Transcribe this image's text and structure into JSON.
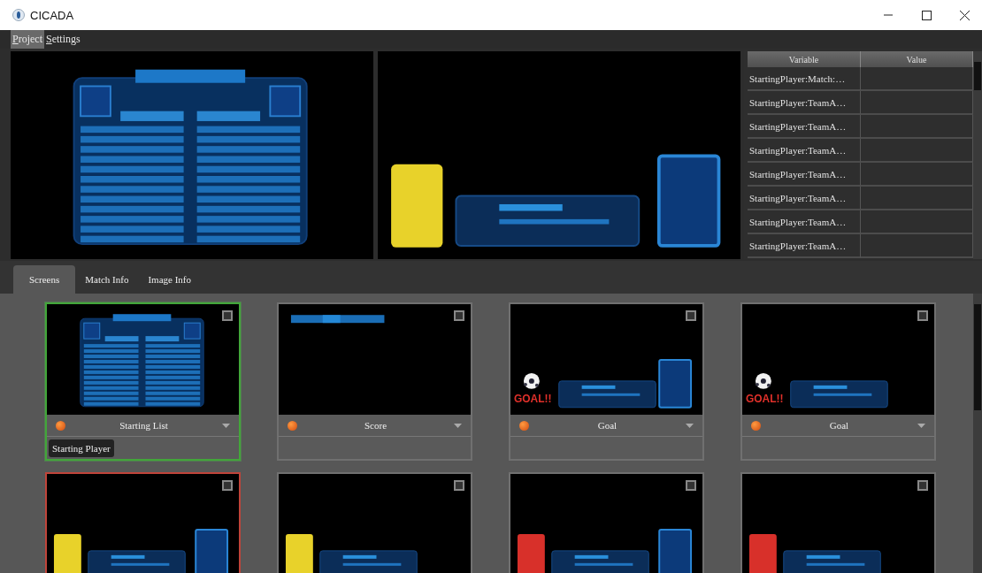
{
  "window": {
    "title": "CICADA"
  },
  "menu": [
    {
      "label": "Project",
      "selected": true
    },
    {
      "label": "Settings",
      "selected": false
    }
  ],
  "previews": [
    {
      "kind": "list"
    },
    {
      "kind": "card",
      "color": "#e8d22a",
      "side_box": true
    }
  ],
  "variables": {
    "columns": [
      "Variable",
      "Value"
    ],
    "rows": [
      {
        "variable": "StartingPlayer:Match:…"
      },
      {
        "variable": "StartingPlayer:TeamA…"
      },
      {
        "variable": "StartingPlayer:TeamA…"
      },
      {
        "variable": "StartingPlayer:TeamA…"
      },
      {
        "variable": "StartingPlayer:TeamA…"
      },
      {
        "variable": "StartingPlayer:TeamA…"
      },
      {
        "variable": "StartingPlayer:TeamA…"
      },
      {
        "variable": "StartingPlayer:TeamA…"
      }
    ]
  },
  "tabs": [
    {
      "label": "Screens",
      "selected": true
    },
    {
      "label": "Match Info",
      "selected": false
    },
    {
      "label": "Image Info",
      "selected": false
    }
  ],
  "screens": [
    {
      "name": "Starting List",
      "selected": true,
      "color": "#43a63a",
      "checked": false,
      "thumbnail": {
        "kind": "list"
      },
      "tags": [
        "Starting Player"
      ]
    },
    {
      "name": "Score",
      "selected": false,
      "color": "#707070",
      "checked": false,
      "thumbnail": {
        "kind": "score"
      }
    },
    {
      "name": "Goal",
      "selected": false,
      "color": "#707070",
      "checked": false,
      "thumbnail": {
        "kind": "goal",
        "caption": "GOAL!!",
        "side_box": true
      }
    },
    {
      "name": "Goal",
      "selected": false,
      "color": "#707070",
      "checked": false,
      "thumbnail": {
        "kind": "goal",
        "caption": "GOAL!!",
        "side_box": false
      }
    },
    {
      "selected": false,
      "color": "#c0443a",
      "checked": false,
      "thumbnail": {
        "kind": "card",
        "color": "#e8d22a",
        "side_box": true
      }
    },
    {
      "selected": false,
      "color": "#707070",
      "checked": false,
      "thumbnail": {
        "kind": "card",
        "color": "#e8d22a",
        "side_box": false
      }
    },
    {
      "selected": false,
      "color": "#707070",
      "checked": false,
      "thumbnail": {
        "kind": "card",
        "color": "#d8302a",
        "side_box": true
      }
    },
    {
      "selected": false,
      "color": "#707070",
      "checked": false,
      "thumbnail": {
        "kind": "card",
        "color": "#d8302a",
        "side_box": false
      }
    }
  ]
}
